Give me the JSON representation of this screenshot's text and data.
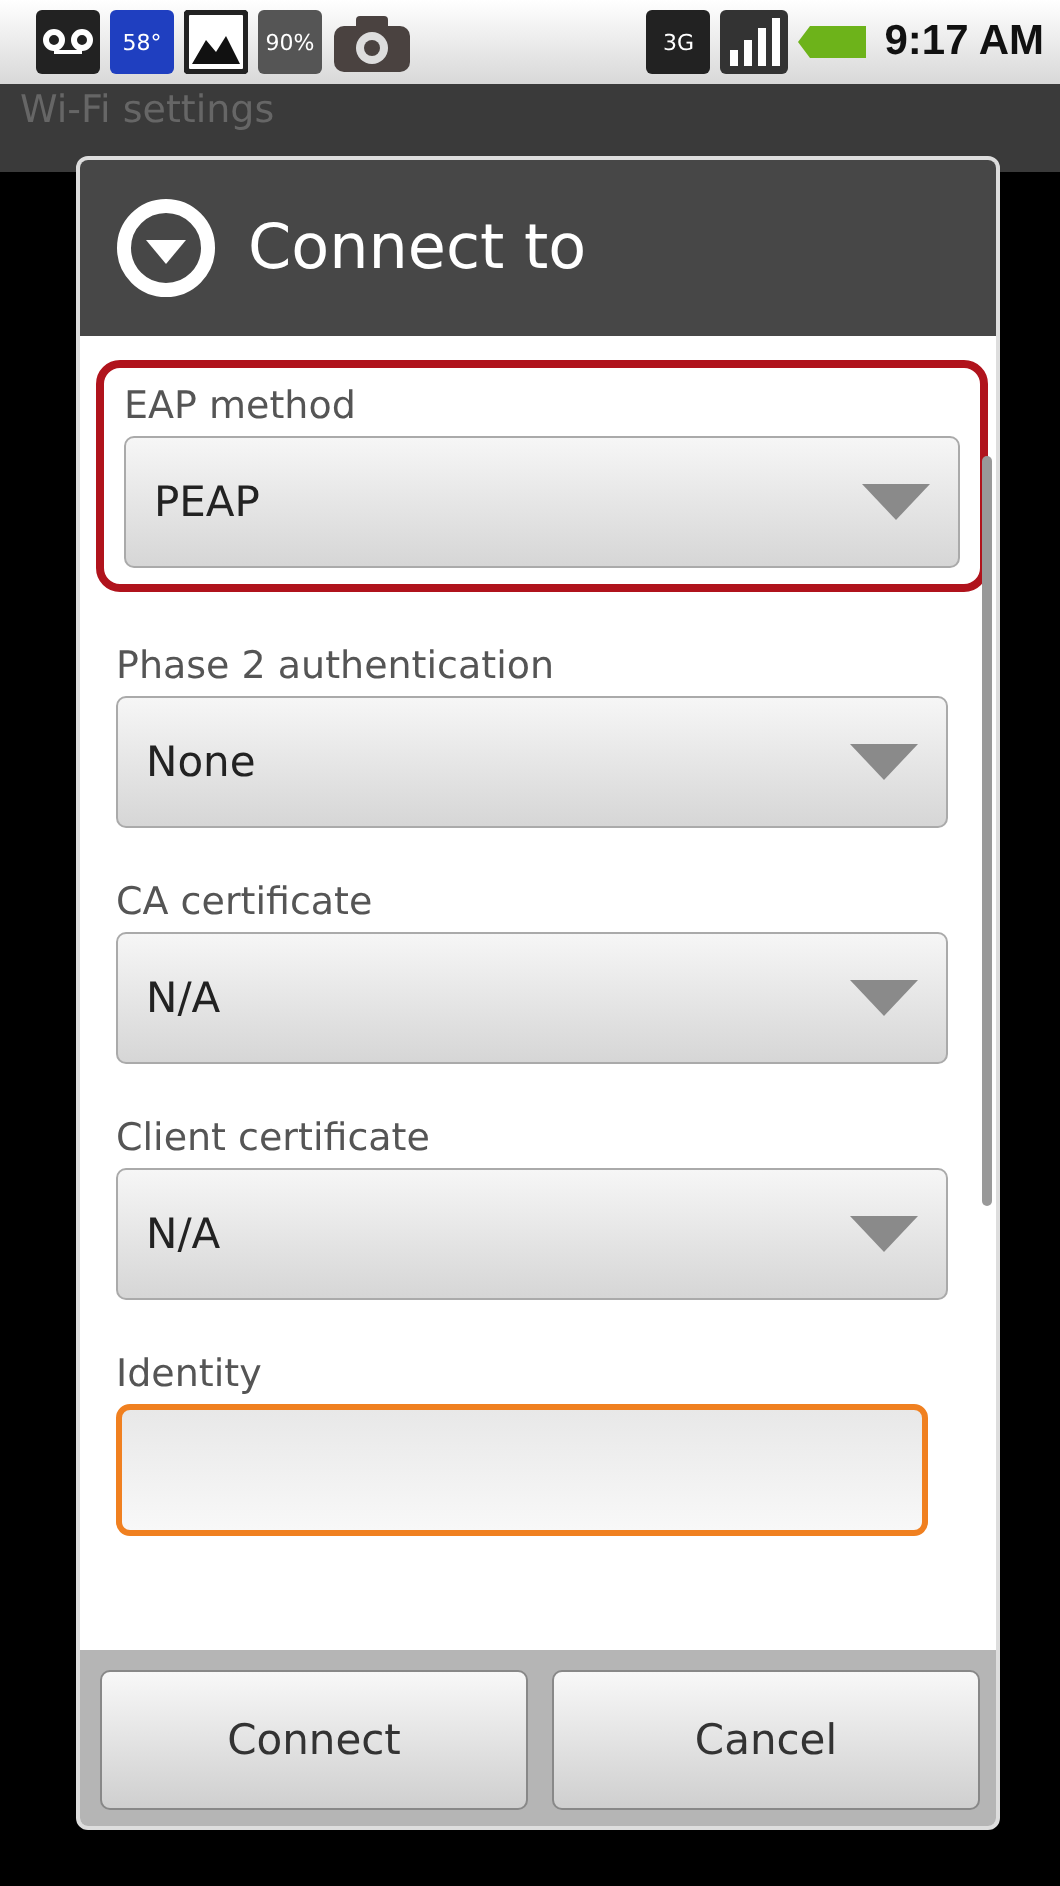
{
  "status_bar": {
    "weather_badge": "58°",
    "battery_badge": "90%",
    "network_badge": "3G",
    "time": "9:17 AM"
  },
  "background_title": "Wi-Fi settings",
  "dialog": {
    "title": "Connect to",
    "fields": [
      {
        "kind": "spinner",
        "label": "EAP method",
        "value": "PEAP",
        "highlighted": true
      },
      {
        "kind": "spinner",
        "label": "Phase 2 authentication",
        "value": "None",
        "highlighted": false
      },
      {
        "kind": "spinner",
        "label": "CA certificate",
        "value": "N/A",
        "highlighted": false
      },
      {
        "kind": "spinner",
        "label": "Client certificate",
        "value": "N/A",
        "highlighted": false
      },
      {
        "kind": "text",
        "label": "Identity",
        "focused": true
      }
    ],
    "buttons": [
      "Connect",
      "Cancel"
    ]
  }
}
